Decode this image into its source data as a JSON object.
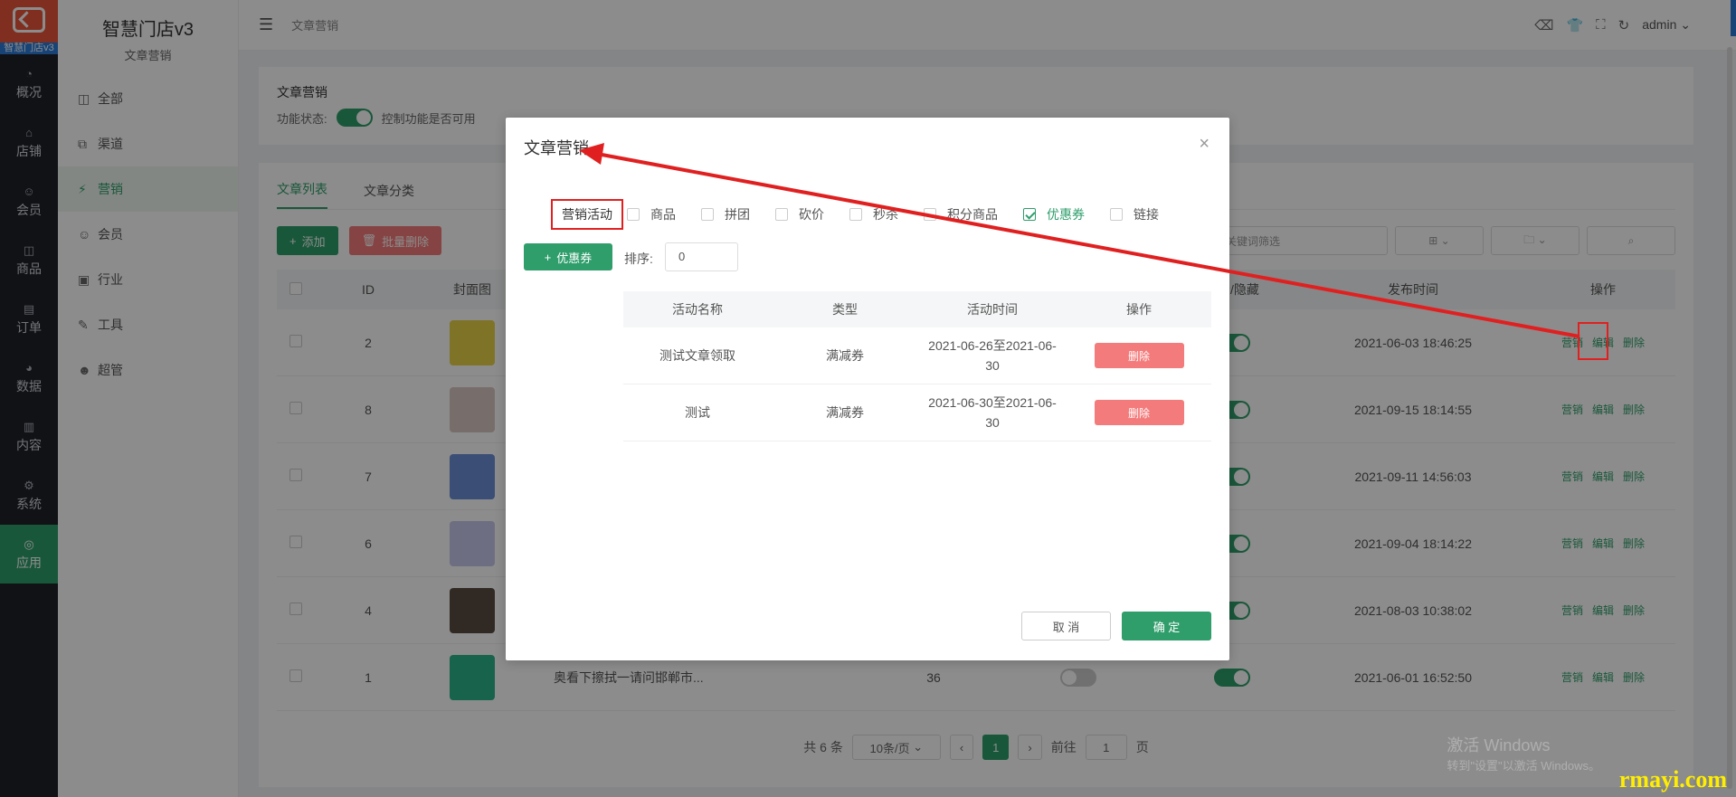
{
  "rail": {
    "logo_text": "智慧门店v3",
    "items": [
      {
        "icon": "◔",
        "label": "概况"
      },
      {
        "icon": "⌂",
        "label": "店铺"
      },
      {
        "icon": "☺",
        "label": "会员"
      },
      {
        "icon": "◫",
        "label": "商品"
      },
      {
        "icon": "▤",
        "label": "订单"
      },
      {
        "icon": "◕",
        "label": "数据"
      },
      {
        "icon": "▥",
        "label": "内容"
      },
      {
        "icon": "⚙",
        "label": "系统"
      },
      {
        "icon": "◎",
        "label": "应用"
      }
    ]
  },
  "side2": {
    "title": "智慧门店v3",
    "subtitle": "文章营销",
    "items": [
      {
        "icon": "◫",
        "label": "全部"
      },
      {
        "icon": "⧉",
        "label": "渠道"
      },
      {
        "icon": "⚡",
        "label": "营销"
      },
      {
        "icon": "☺",
        "label": "会员"
      },
      {
        "icon": "▣",
        "label": "行业"
      },
      {
        "icon": "✎",
        "label": "工具"
      },
      {
        "icon": "☻",
        "label": "超管"
      }
    ]
  },
  "topbar": {
    "breadcrumb": "文章营销",
    "user": "admin"
  },
  "card1": {
    "title": "文章营销",
    "status_label": "功能状态:",
    "status_desc": "控制功能是否可用"
  },
  "tabs": [
    "文章列表",
    "文章分类"
  ],
  "toolbar": {
    "add": "添加",
    "batch_delete": "批量删除",
    "search_placeholder": "关键词筛选"
  },
  "table": {
    "headers": {
      "id": "ID",
      "cover": "封面图",
      "show": "显示/隐藏",
      "publish": "发布时间",
      "ops": "操作"
    },
    "rows": [
      {
        "id": "2",
        "thumb": "#e8d24a",
        "title": "",
        "num": "",
        "time": "2021-06-03 18:46:25"
      },
      {
        "id": "8",
        "thumb": "#d9c8c4",
        "title": "",
        "num": "",
        "time": "2021-09-15 18:14:55"
      },
      {
        "id": "7",
        "thumb": "#6b8fd8",
        "title": "",
        "num": "",
        "time": "2021-09-11 14:56:03"
      },
      {
        "id": "6",
        "thumb": "#c9c9ee",
        "title": "",
        "num": "",
        "time": "2021-09-04 18:14:22"
      },
      {
        "id": "4",
        "thumb": "#5a4d42",
        "title": "",
        "num": "",
        "time": "2021-08-03 10:38:02"
      },
      {
        "id": "1",
        "thumb": "#2bb58a",
        "title": "奥看下擦拭一请问邯郸市...",
        "num": "36",
        "time": "2021-06-01 16:52:50"
      }
    ],
    "op_labels": {
      "market": "营销",
      "edit": "编辑",
      "delete": "删除"
    }
  },
  "pager": {
    "total": "共 6 条",
    "size": "10条/页",
    "current": "1",
    "goto": "前往",
    "page_unit": "页",
    "goto_value": "1"
  },
  "modal": {
    "title": "文章营销",
    "close": "×",
    "options": [
      {
        "label": "营销活动",
        "checked": false,
        "highlight": true
      },
      {
        "label": "商品",
        "checked": false
      },
      {
        "label": "拼团",
        "checked": false
      },
      {
        "label": "砍价",
        "checked": false
      },
      {
        "label": "秒杀",
        "checked": false
      },
      {
        "label": "积分商品",
        "checked": false
      },
      {
        "label": "优惠券",
        "checked": true
      },
      {
        "label": "链接",
        "checked": false
      }
    ],
    "coupon_btn": "优惠券",
    "sort_label": "排序:",
    "sort_value": "0",
    "headers": [
      "活动名称",
      "类型",
      "活动时间",
      "操作"
    ],
    "rows": [
      {
        "name": "测试文章领取",
        "type": "满减券",
        "time1": "2021-06-26至2021-06-",
        "time2": "30",
        "op": "删除"
      },
      {
        "name": "测试",
        "type": "满减券",
        "time1": "2021-06-30至2021-06-",
        "time2": "30",
        "op": "删除"
      }
    ],
    "cancel": "取 消",
    "ok": "确 定"
  },
  "watermark": {
    "line1": "激活 Windows",
    "line2": "转到\"设置\"以激活 Windows。",
    "brand": "rmayi.com"
  },
  "colors": {
    "primary": "#2f9e6b",
    "danger": "#f47b7b",
    "annotation": "#e02020"
  }
}
